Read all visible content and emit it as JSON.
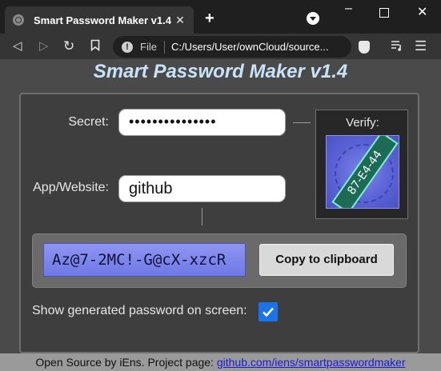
{
  "browser": {
    "tab_title": "Smart Password Maker v1.4",
    "tab_close": "✕",
    "new_tab": "+",
    "address_scheme_label": "File",
    "address_url": "C:/Users/User/ownCloud/source...",
    "info_glyph": "!"
  },
  "app": {
    "title": "Smart Password Maker v1.4",
    "secret_label": "Secret:",
    "secret_value": "•••••••••••••••",
    "app_label": "App/Website:",
    "app_value": "github",
    "verify_label": "Verify:",
    "verify_code": "87-E4-44",
    "generated_password": "Az@7-2MC!-G@cX-xzcR",
    "copy_button_label": "Copy to clipboard",
    "show_password_label": "Show generated password on screen:",
    "show_password_checked": true
  },
  "footer": {
    "text": "Open Source by iEns. Project page: ",
    "link_text": "github.com/iens/smartpasswordmaker"
  },
  "colors": {
    "title": "#c8e3f8",
    "verify_code_bg": "#1e6b55",
    "password_bg": "#7b84ec",
    "checkbox": "#1a73e8",
    "link": "#1a1ad8"
  }
}
